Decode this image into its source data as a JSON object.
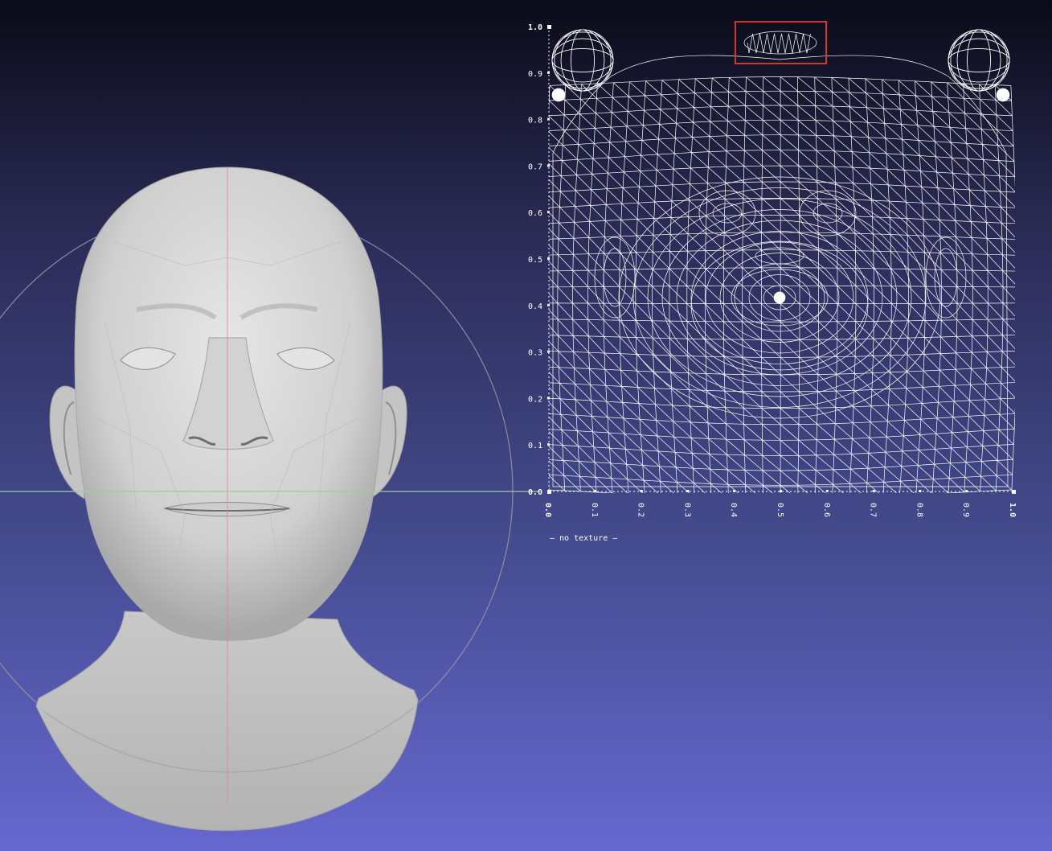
{
  "uv_panel": {
    "y_axis_ticks": [
      "1.0",
      "0.9",
      "0.8",
      "0.7",
      "0.6",
      "0.5",
      "0.4",
      "0.3",
      "0.2",
      "0.1",
      "0.0"
    ],
    "x_axis_ticks": [
      "0.0",
      "0.1",
      "0.2",
      "0.3",
      "0.4",
      "0.5",
      "0.6",
      "0.7",
      "0.8",
      "0.9",
      "1.0"
    ],
    "texture_status": "— no texture —",
    "highlight_color": "#d9342b",
    "wire_color": "#ffffff"
  },
  "viewport": {
    "background_top": "#0a0b18",
    "background_bottom": "#6668d0",
    "mesh_color": "#d4d4d4",
    "vertical_axis_color": "#e08a8a",
    "horizontal_axis_color": "#9ccc9c",
    "trackball_color": "#9a9aa6"
  }
}
